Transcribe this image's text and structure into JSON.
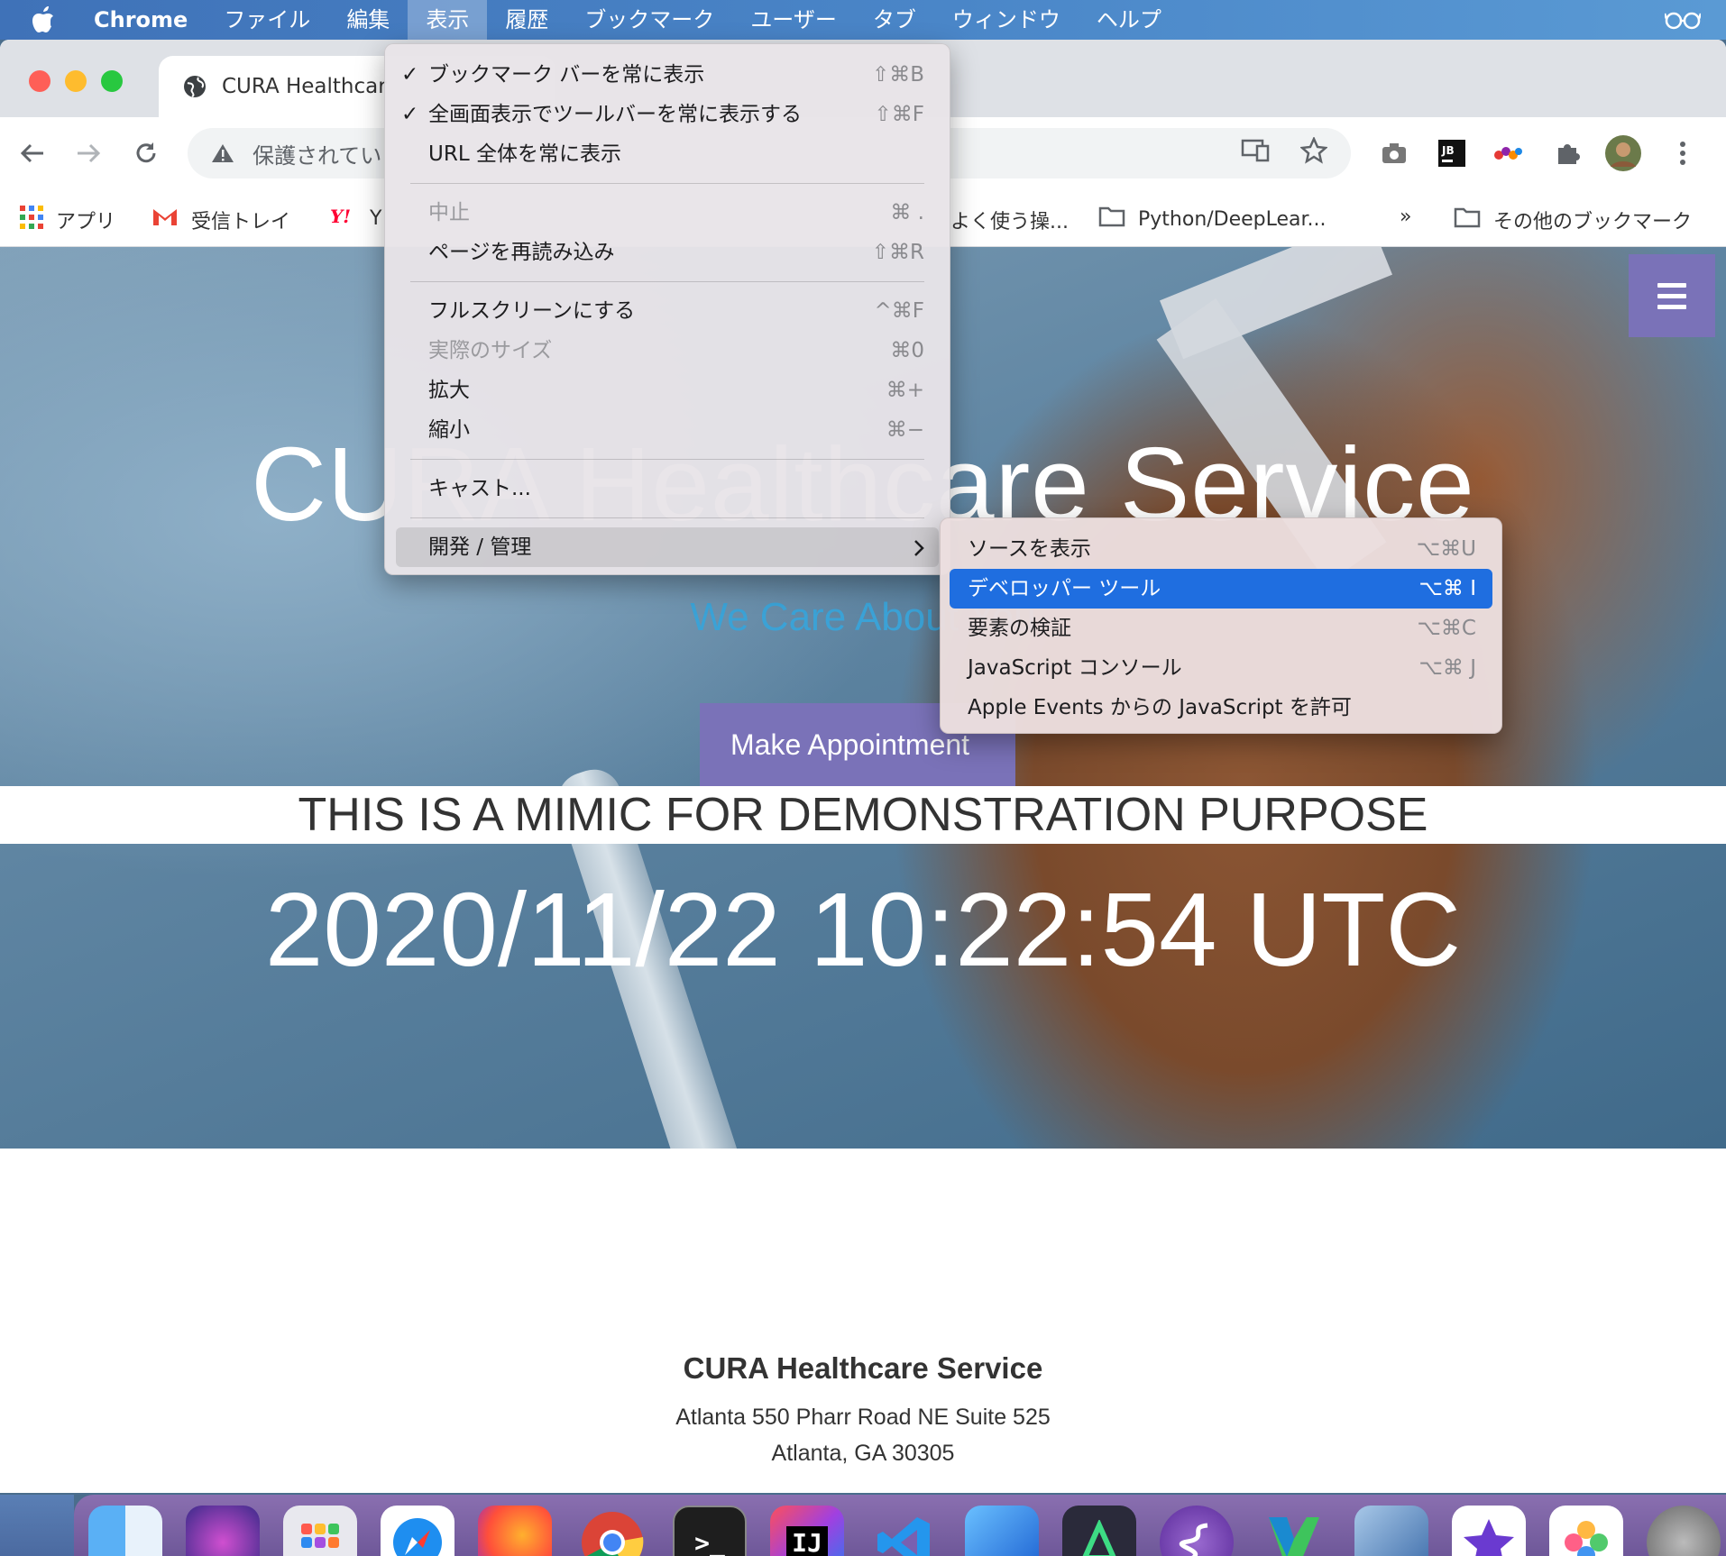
{
  "menubar": {
    "app": "Chrome",
    "items": [
      "ファイル",
      "編集",
      "表示",
      "履歴",
      "ブックマーク",
      "ユーザー",
      "タブ",
      "ウィンドウ",
      "ヘルプ"
    ]
  },
  "tab": {
    "title": "CURA Healthcar"
  },
  "omnibox": {
    "security_text": "保護されてい"
  },
  "bookmarks": {
    "apps": "アプリ",
    "gmail": "受信トレイ",
    "yahoo": "Y",
    "frequent": "よく使う操...",
    "python": "Python/DeepLear...",
    "overflow": "»",
    "other": "その他のブックマーク"
  },
  "view_menu": {
    "items": [
      {
        "label": "ブックマーク バーを常に表示",
        "shortcut": "⇧⌘B",
        "checked": "✓"
      },
      {
        "label": "全画面表示でツールバーを常に表示する",
        "shortcut": "⇧⌘F",
        "checked": "✓"
      },
      {
        "label": "URL 全体を常に表示",
        "shortcut": ""
      },
      {
        "label": "中止",
        "shortcut": "⌘ ."
      },
      {
        "label": "ページを再読み込み",
        "shortcut": "⇧⌘R"
      },
      {
        "label": "フルスクリーンにする",
        "shortcut": "^⌘F"
      },
      {
        "label": "実際のサイズ",
        "shortcut": "⌘0"
      },
      {
        "label": "拡大",
        "shortcut": "⌘+"
      },
      {
        "label": "縮小",
        "shortcut": "⌘−"
      },
      {
        "label": "キャスト...",
        "shortcut": ""
      },
      {
        "label": "開発 / 管理",
        "shortcut": ""
      }
    ]
  },
  "dev_menu": {
    "items": [
      {
        "label": "ソースを表示",
        "shortcut": "⌥⌘U"
      },
      {
        "label": "デベロッパー ツール",
        "shortcut": "⌥⌘ I"
      },
      {
        "label": "要素の検証",
        "shortcut": "⌥⌘C"
      },
      {
        "label": "JavaScript コンソール",
        "shortcut": "⌥⌘ J"
      },
      {
        "label": "Apple Events からの JavaScript を許可",
        "shortcut": ""
      }
    ]
  },
  "page": {
    "hero_title": "CURA Healthcare Service",
    "hero_subtitle": "We Care About You",
    "appointment_button": "Make Appointment",
    "mimic_notice": "THIS IS A MIMIC FOR DEMONSTRATION PURPOSE",
    "timestamp": "2020/11/22 10:22:54 UTC"
  },
  "footer": {
    "name": "CURA Healthcare Service",
    "address_line1": "Atlanta 550 Pharr Road NE Suite 525",
    "address_line2": "Atlanta, GA 30305"
  },
  "dock": {
    "apps": [
      "finder-icon",
      "siri-icon",
      "launchpad-icon",
      "safari-icon",
      "firefox-icon",
      "chrome-icon",
      "terminal-icon",
      "intellij-icon",
      "vscode-icon",
      "xcode-beta-icon",
      "android-studio-icon",
      "emacs-icon",
      "vim-icon",
      "virtualbox-icon",
      "imovie-icon",
      "photos-icon",
      "system-preferences-icon"
    ],
    "terminal_glyph": ">_",
    "intellij_glyph": "IJ"
  },
  "colors": {
    "accent_purple": "#7a72b8",
    "menu_highlight": "#1f6ee0",
    "subtitle_blue": "#3ba2d6"
  }
}
